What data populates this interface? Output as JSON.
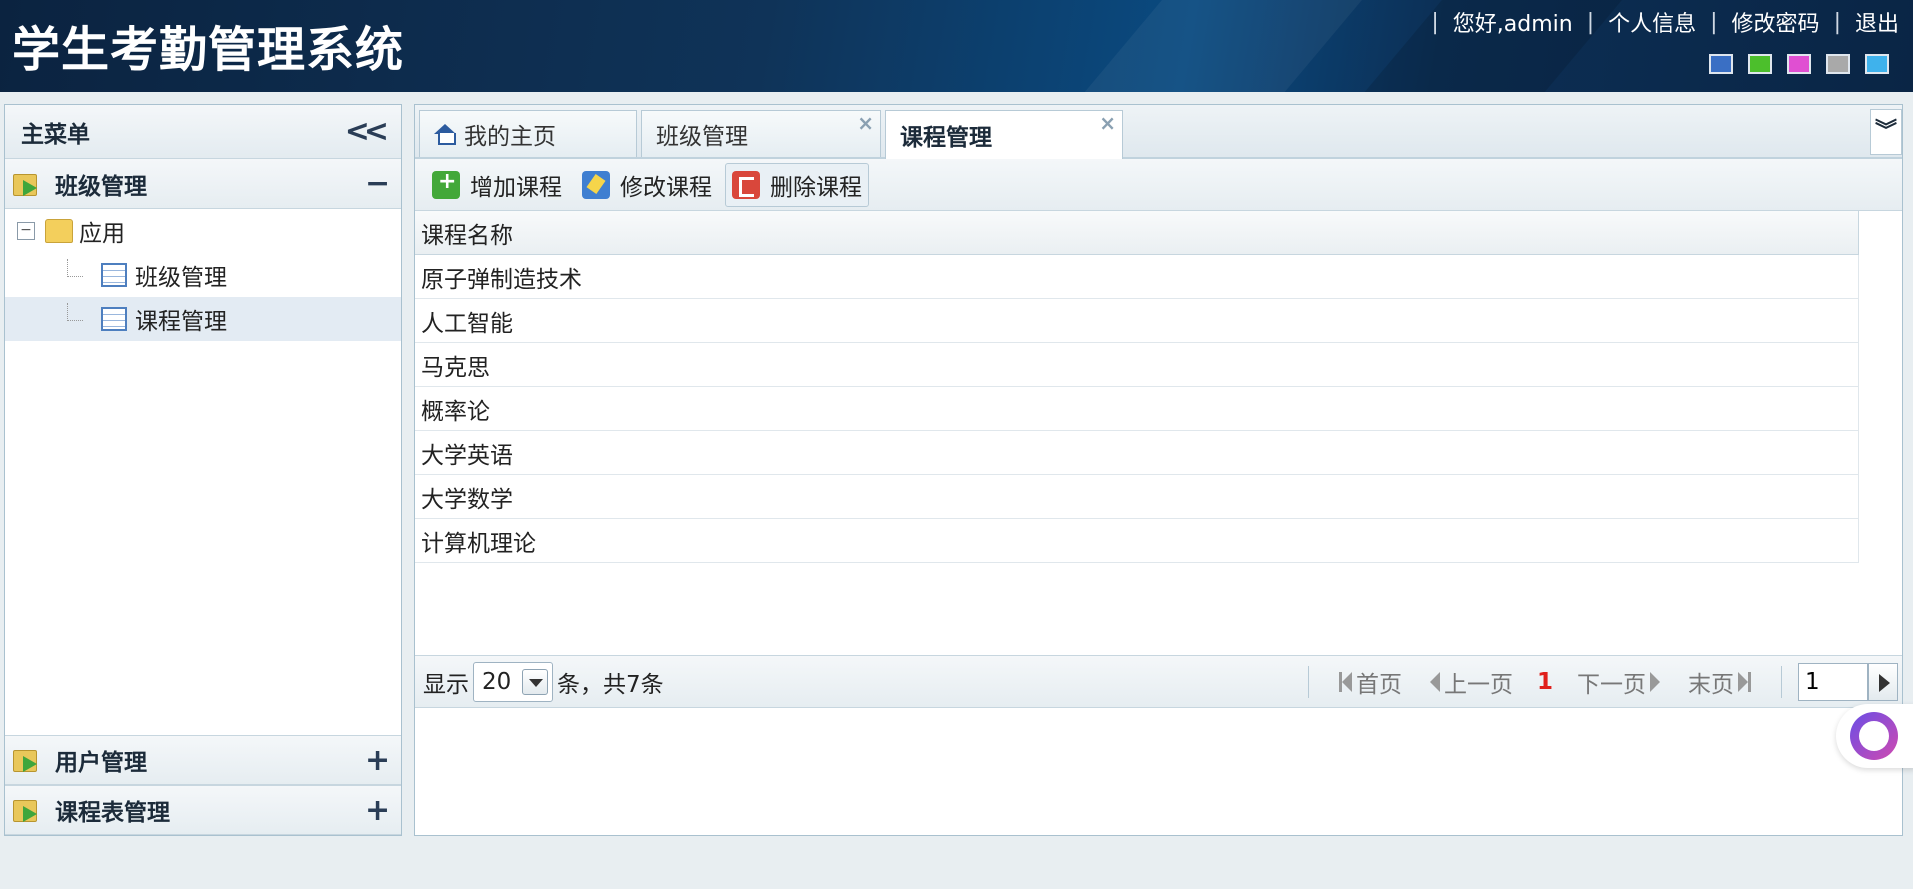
{
  "header": {
    "title": "学生考勤管理系统",
    "greeting": "您好,admin",
    "links": [
      "个人信息",
      "修改密码",
      "退出"
    ],
    "sep": "|",
    "themes": [
      "#3a6fc4",
      "#4cbf2c",
      "#e04fd2",
      "#a9a9a9",
      "#3fb2ec"
    ]
  },
  "sidebar": {
    "title": "主菜单",
    "collapse_icon": "double-chevron-left-icon",
    "panels": [
      {
        "label": "班级管理",
        "toggle": "−"
      },
      {
        "label": "用户管理",
        "toggle": "+"
      },
      {
        "label": "课程表管理",
        "toggle": "+"
      }
    ],
    "tree": {
      "root": "应用",
      "root_toggle": "−",
      "items": [
        "班级管理",
        "课程管理"
      ]
    }
  },
  "tabs": [
    {
      "label": "我的主页"
    },
    {
      "label": "班级管理",
      "close": "×"
    },
    {
      "label": "课程管理",
      "close": "×"
    }
  ],
  "tabs_more": "»",
  "toolbar": {
    "add": "增加课程",
    "edit": "修改课程",
    "delete": "删除课程"
  },
  "grid": {
    "header": "课程名称",
    "rows": [
      "原子弹制造技术",
      "人工智能",
      "马克思",
      "概率论",
      "大学英语",
      "大学数学",
      "计算机理论"
    ]
  },
  "pager": {
    "show": "显示",
    "page_size": "20",
    "total": "条，共7条",
    "first": "首页",
    "prev": "上一页",
    "current": "1",
    "next": "下一页",
    "last": "末页",
    "jump_value": "1"
  }
}
